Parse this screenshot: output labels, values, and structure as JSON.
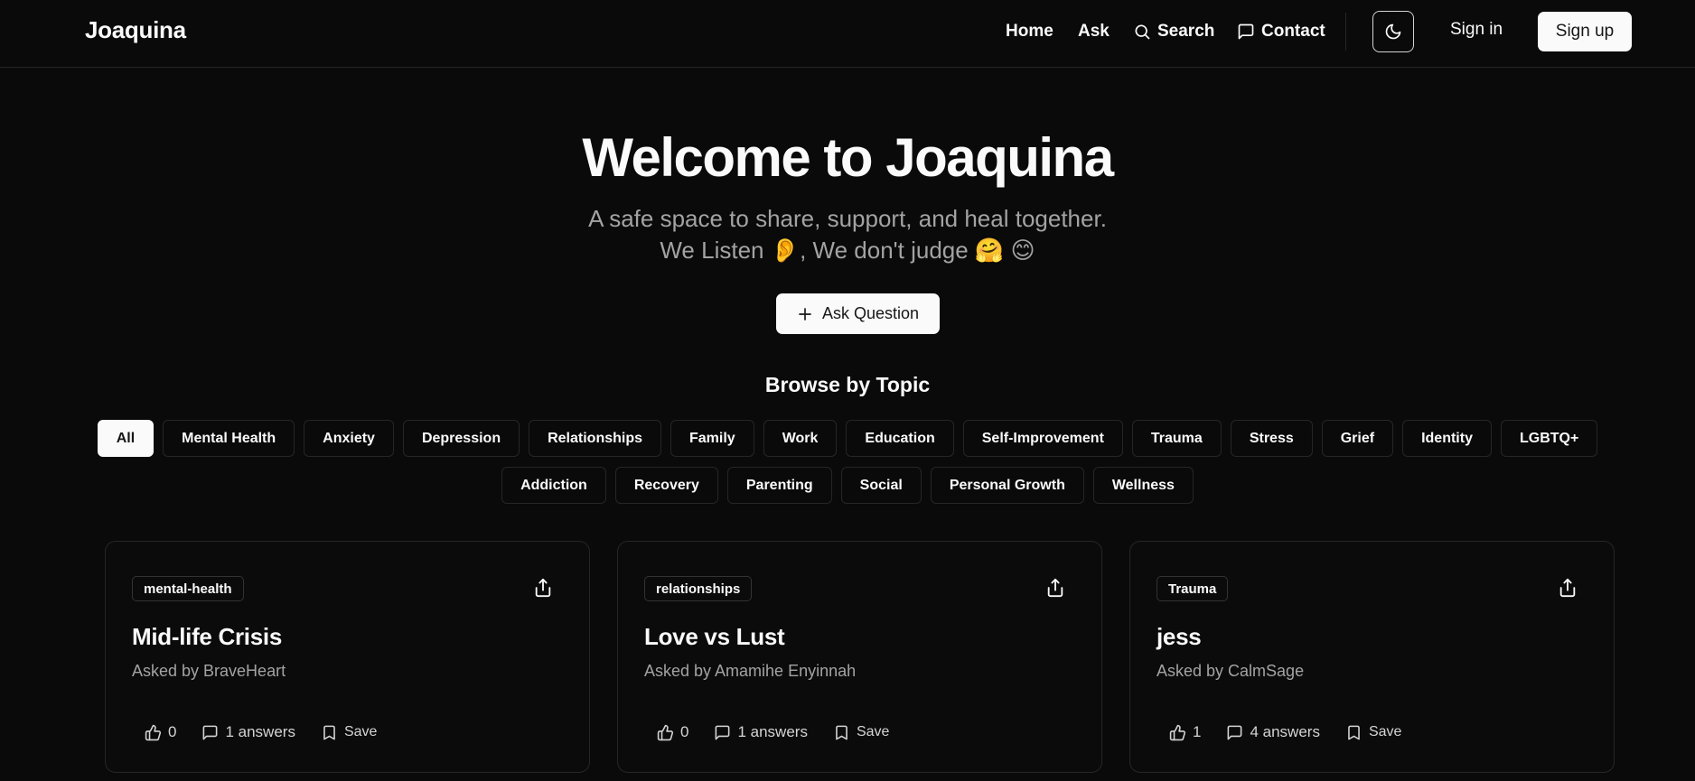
{
  "header": {
    "logo": "Joaquina",
    "nav": {
      "home": "Home",
      "ask": "Ask",
      "search": "Search",
      "contact": "Contact"
    },
    "theme_icon": "moon-icon",
    "signin": "Sign in",
    "signup": "Sign up"
  },
  "hero": {
    "title": "Welcome to Joaquina",
    "subtitle_line1": "A safe space to share, support, and heal together.",
    "subtitle_line2": "We Listen 👂, We don't judge 🤗  😊",
    "ask_button": "Ask Question"
  },
  "topics": {
    "title": "Browse by Topic",
    "row1": [
      "All",
      "Mental Health",
      "Anxiety",
      "Depression",
      "Relationships",
      "Family",
      "Work",
      "Education",
      "Self-Improvement",
      "Trauma",
      "Stress",
      "Grief",
      "Identity",
      "LGBTQ+"
    ],
    "row2": [
      "Addiction",
      "Recovery",
      "Parenting",
      "Social",
      "Personal Growth",
      "Wellness"
    ],
    "active": "All"
  },
  "cards": [
    {
      "tag": "mental-health",
      "title": "Mid-life Crisis",
      "author": "Asked by BraveHeart",
      "likes": "0",
      "answers": "1 answers",
      "save": "Save"
    },
    {
      "tag": "relationships",
      "title": "Love vs Lust",
      "author": "Asked by Amamihe Enyinnah",
      "likes": "0",
      "answers": "1 answers",
      "save": "Save"
    },
    {
      "tag": "Trauma",
      "title": "jess",
      "author": "Asked by CalmSage",
      "likes": "1",
      "answers": "4 answers",
      "save": "Save"
    }
  ],
  "colors": {
    "background": "#0a0a0a",
    "foreground": "#fafafa",
    "muted": "#a3a3a3",
    "border": "#262626"
  }
}
